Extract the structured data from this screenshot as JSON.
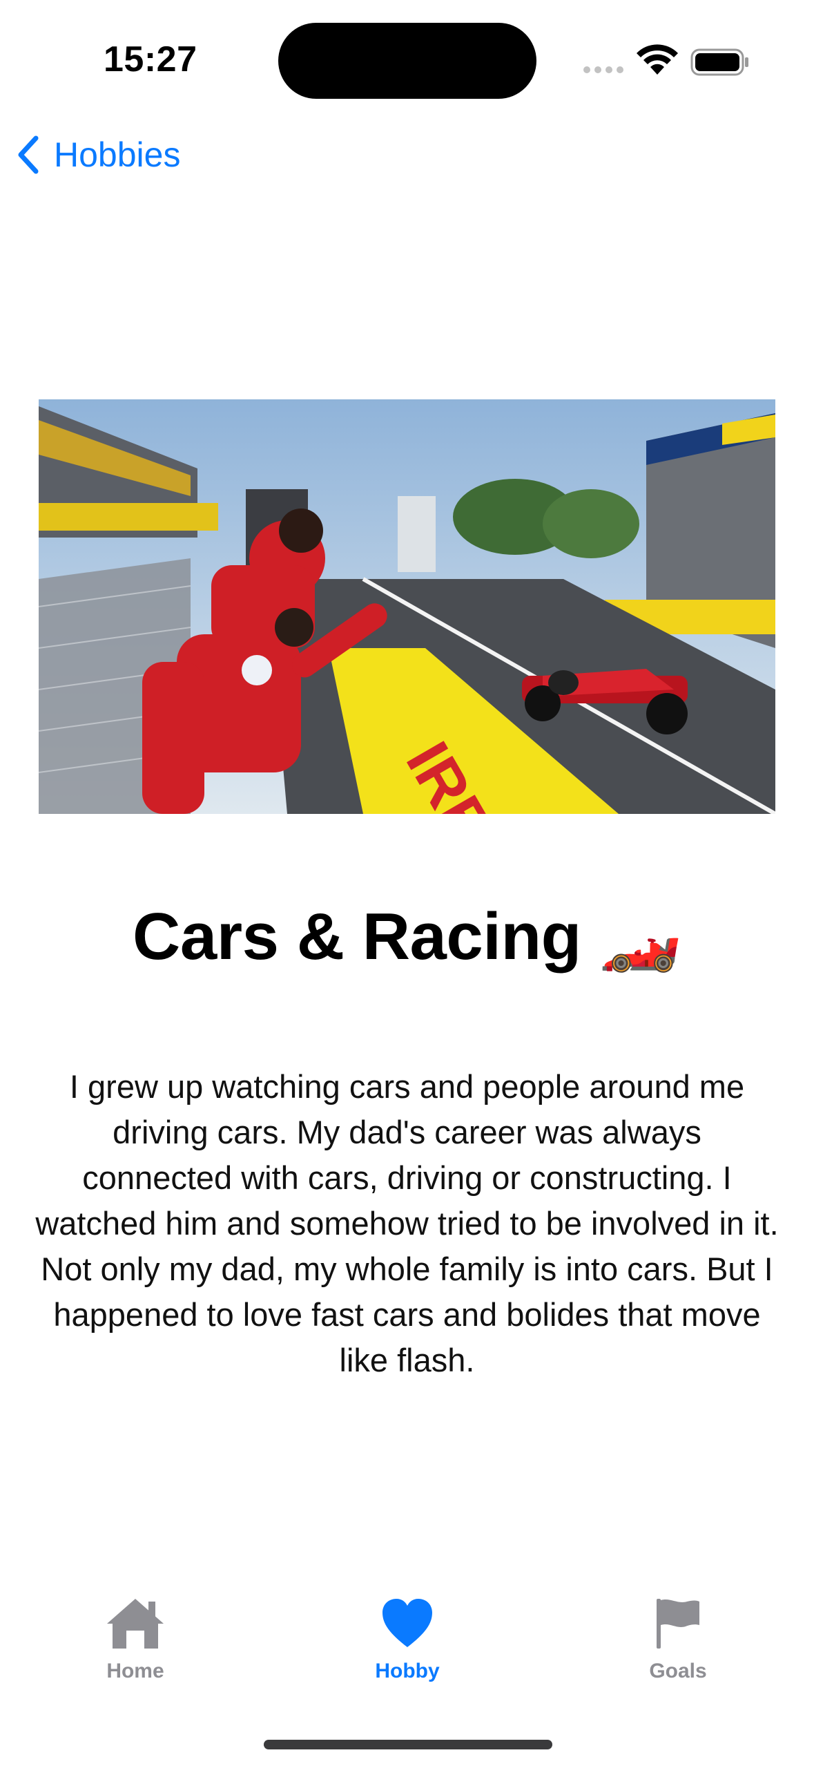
{
  "status_bar": {
    "time": "15:27"
  },
  "nav": {
    "back_label": "Hobbies"
  },
  "hero": {
    "alt": "Cars & Racing"
  },
  "content": {
    "title": "Cars & Racing 🏎️",
    "body": "I grew up watching cars and people around me driving cars. My dad's career was always connected with cars, driving or constructing. I watched him and somehow tried to be involved in it. Not only my dad, my whole family is into cars. But I happened to love fast cars and bolides that move like flash."
  },
  "tabbar": {
    "tabs": [
      {
        "label": "Home",
        "icon": "house-icon",
        "selected": false
      },
      {
        "label": "Hobby",
        "icon": "heart-icon",
        "selected": true
      },
      {
        "label": "Goals",
        "icon": "flag-icon",
        "selected": false
      }
    ]
  },
  "colors": {
    "accent": "#0a7aff",
    "inactive": "#8e8e93"
  }
}
